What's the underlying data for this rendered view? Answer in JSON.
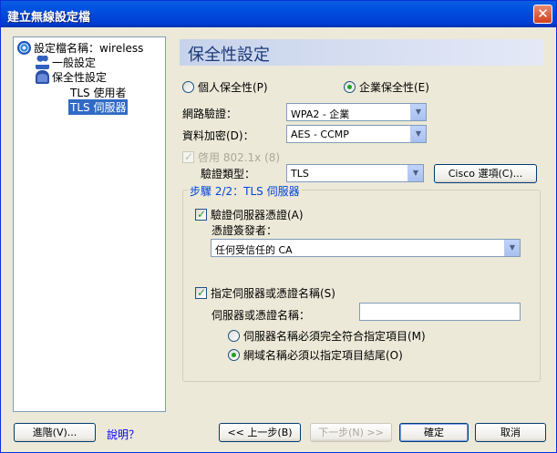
{
  "window": {
    "title": "建立無線設定檔",
    "close_glyph": "✕"
  },
  "tree": {
    "profile_label": "設定檔名稱：wireless",
    "general": "一般設定",
    "security": "保全性設定",
    "tls_user": "TLS 使用者",
    "tls_server": "TLS 伺服器"
  },
  "header": {
    "title": "保全性設定"
  },
  "security_mode": {
    "personal": "個人保全性(P)",
    "enterprise": "企業保全性(E)",
    "selected": "enterprise"
  },
  "fields": {
    "auth_label": "網路驗證：",
    "auth_value": "WPA2 - 企業",
    "encrypt_label": "資料加密(D)：",
    "encrypt_value": "AES - CCMP",
    "enable_8021x": "啓用 802.1x (8)",
    "eap_label": "驗證類型：",
    "eap_value": "TLS",
    "cisco_button": "Cisco 選項(C)..."
  },
  "step_group": {
    "title": "步驟 2/2：TLS 伺服器",
    "validate_cert": "驗證伺服器憑證(A)",
    "issuer_label": "憑證簽發者：",
    "issuer_value": "任何受信任的 CA",
    "specify_name": "指定伺服器或憑證名稱(S)",
    "server_name_label": "伺服器或憑證名稱：",
    "server_name_value": "",
    "match_exact": "伺服器名稱必須完全符合指定項目(M)",
    "match_suffix": "網域名稱必須以指定項目結尾(O)"
  },
  "footer": {
    "advanced": "進階(V)...",
    "help": "說明？",
    "back": "<< 上一步(B)",
    "next": "下一步(N) >>",
    "ok": "確定",
    "cancel": "取消"
  },
  "icons": {
    "profile": "wifi-icon",
    "general": "people-icon",
    "security": "lock-icon",
    "dropdown": "▼"
  },
  "colors": {
    "title_bar": "#0151e0",
    "group_title": "#0046d5",
    "selection": "#316ac5"
  }
}
